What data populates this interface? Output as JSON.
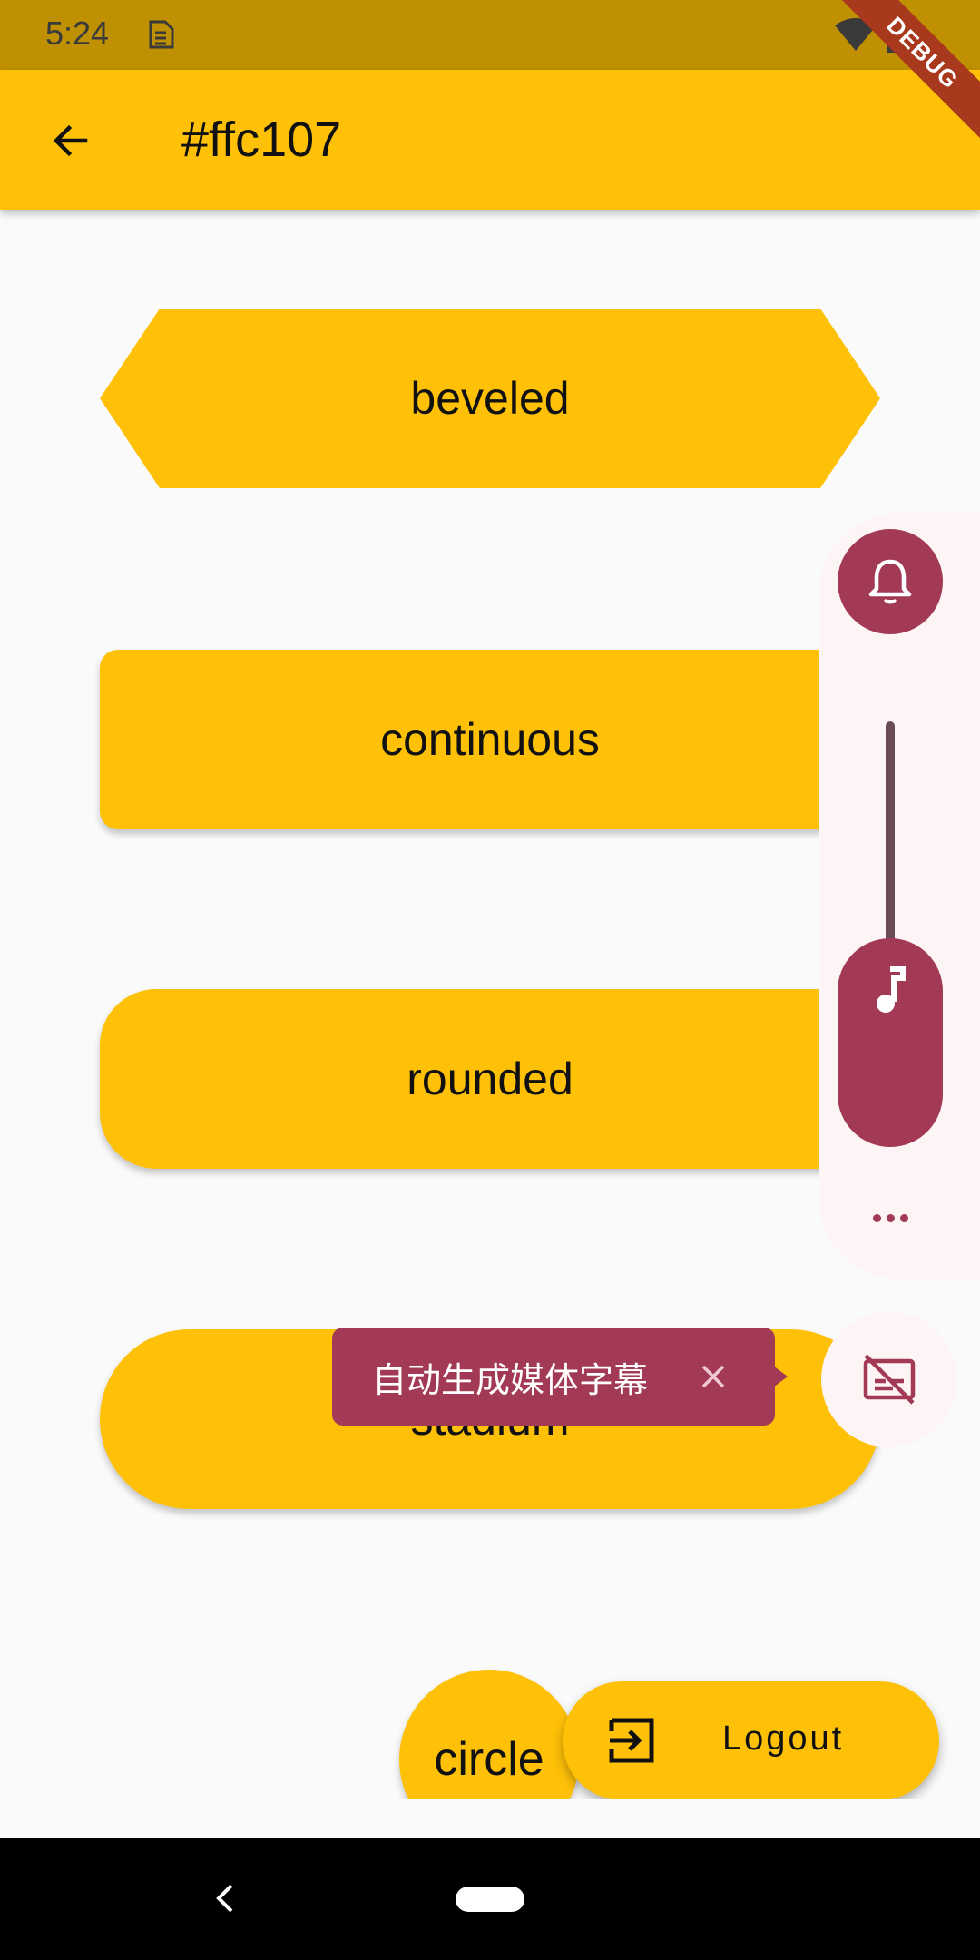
{
  "status_bar": {
    "time": "5:24",
    "debug_label": "DEBUG"
  },
  "app_bar": {
    "title": "#ffc107",
    "back_icon": "arrow-back-icon"
  },
  "buttons": {
    "beveled": "beveled",
    "continuous": "continuous",
    "rounded": "rounded",
    "stadium": "stadium",
    "circle": "circle"
  },
  "volume_panel": {
    "ring_icon": "bell-icon",
    "music_icon": "music-note-icon",
    "more_icon": "more-horiz-icon",
    "captions_icon": "captions-off-icon"
  },
  "tooltip": {
    "text": "自动生成媒体字幕"
  },
  "fab": {
    "label": "Logout",
    "icon": "logout-icon"
  },
  "colors": {
    "primary": "#ffc107",
    "accent": "#a33a55",
    "status": "#bf9102"
  }
}
